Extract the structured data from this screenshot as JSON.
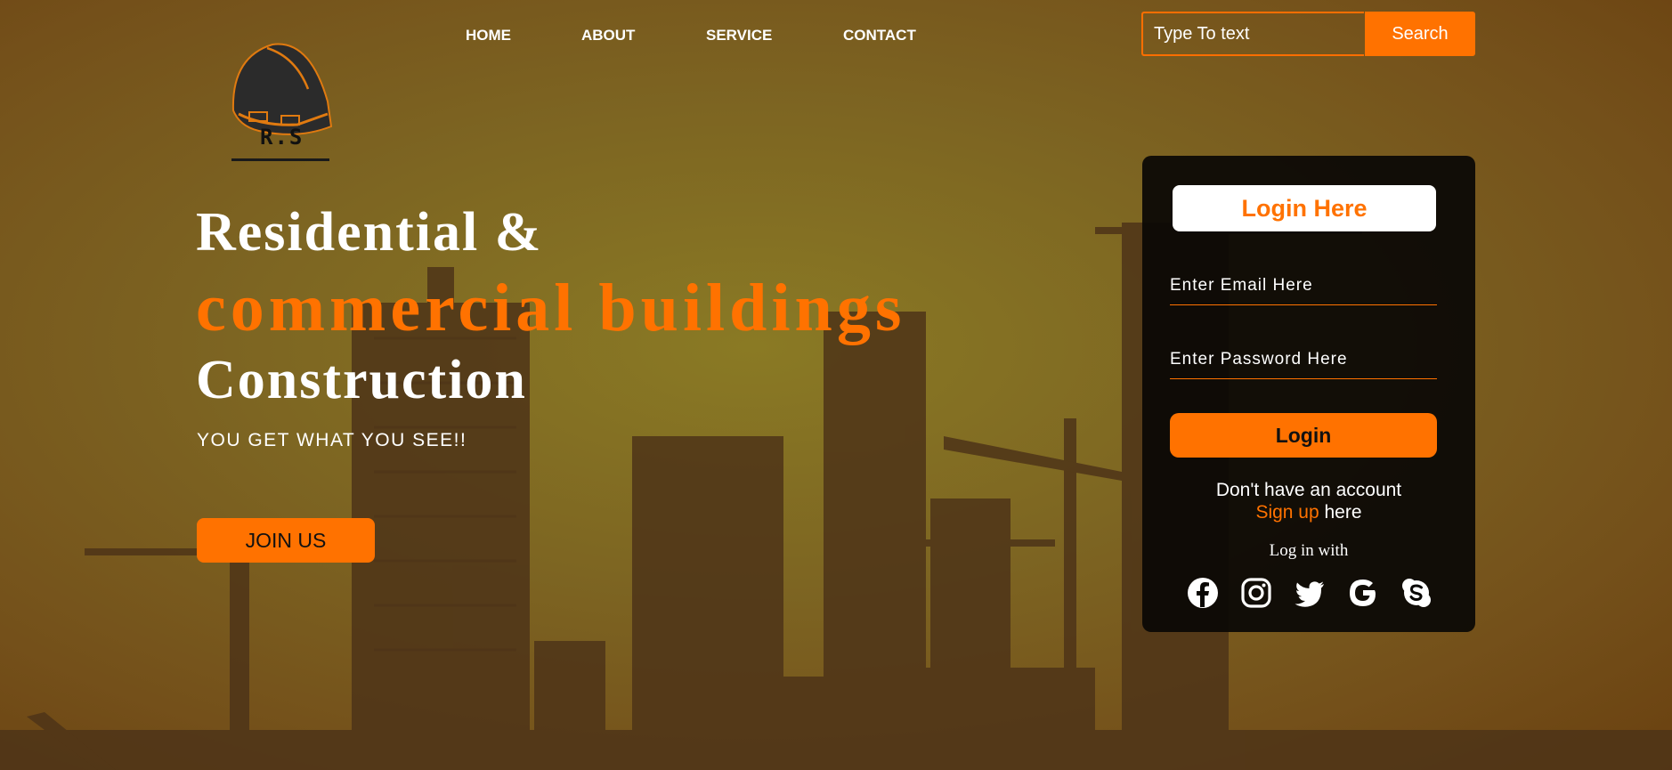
{
  "logo": {
    "text": "R.S"
  },
  "nav": [
    "HOME",
    "ABOUT",
    "SERVICE",
    "CONTACT"
  ],
  "search": {
    "placeholder": "Type To text",
    "button": "Search"
  },
  "hero": {
    "line1": "Residential &",
    "line2": "commercial buildings",
    "line3": "Construction",
    "tagline": "YOU GET WHAT YOU SEE!!",
    "cta": "JOIN US"
  },
  "login": {
    "title": "Login Here",
    "email_placeholder": "Enter Email Here",
    "password_placeholder": "Enter Password Here",
    "button": "Login",
    "no_account": "Don't have an account",
    "signup_link": "Sign up",
    "signup_suffix": " here",
    "log_in_with": "Log in with",
    "socials": [
      "facebook-icon",
      "instagram-icon",
      "twitter-icon",
      "google-icon",
      "skype-icon"
    ]
  },
  "colors": {
    "accent": "#ff7200",
    "panel": "#0a0805",
    "text": "#ffffff"
  }
}
